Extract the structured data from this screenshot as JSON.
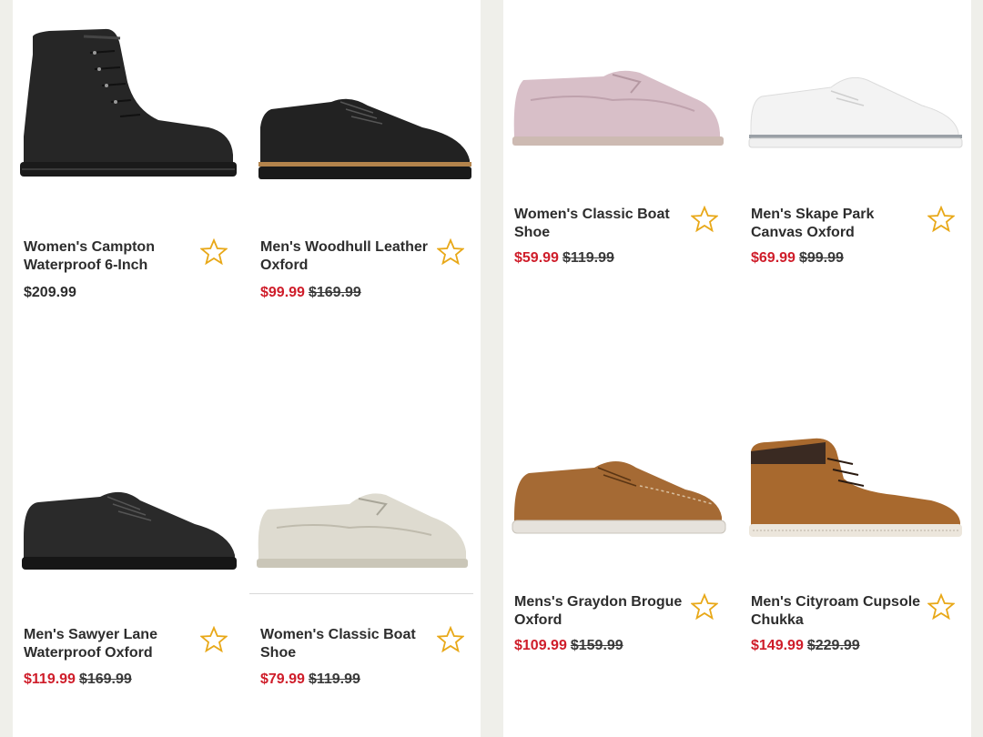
{
  "products": [
    {
      "title": "Women's Campton Waterproof 6-Inch",
      "price": "$209.99",
      "sale_price": "",
      "original_price": "",
      "icon": "star-outline-icon",
      "image": "black-leather-boot"
    },
    {
      "title": "Men's Woodhull Leather Oxford",
      "price": "",
      "sale_price": "$99.99",
      "original_price": "$169.99",
      "icon": "star-outline-icon",
      "image": "black-leather-oxford"
    },
    {
      "title": "Men's Sawyer Lane Waterproof Oxford",
      "price": "",
      "sale_price": "$119.99",
      "original_price": "$169.99",
      "icon": "star-outline-icon",
      "image": "black-nubuck-oxford"
    },
    {
      "title": "Women's Classic Boat Shoe",
      "price": "",
      "sale_price": "$79.99",
      "original_price": "$119.99",
      "icon": "star-outline-icon",
      "image": "cream-boat-shoe"
    },
    {
      "title": "Women's Classic Boat Shoe",
      "price": "",
      "sale_price": "$59.99",
      "original_price": "$119.99",
      "icon": "star-outline-icon",
      "image": "pink-boat-shoe"
    },
    {
      "title": "Men's Skape Park Canvas Oxford",
      "price": "",
      "sale_price": "$69.99",
      "original_price": "$99.99",
      "icon": "star-outline-icon",
      "image": "white-canvas-sneaker"
    },
    {
      "title": "Mens's Graydon Brogue Oxford",
      "price": "",
      "sale_price": "$109.99",
      "original_price": "$159.99",
      "icon": "star-outline-icon",
      "image": "tan-brogue-oxford"
    },
    {
      "title": "Men's Cityroam Cupsole Chukka",
      "price": "",
      "sale_price": "$149.99",
      "original_price": "$229.99",
      "icon": "star-outline-icon",
      "image": "tan-chukka-boot"
    }
  ],
  "colors": {
    "sale": "#cf1d2a",
    "star": "#e8a818",
    "text": "#2d2d2d",
    "background": "#efefea"
  }
}
